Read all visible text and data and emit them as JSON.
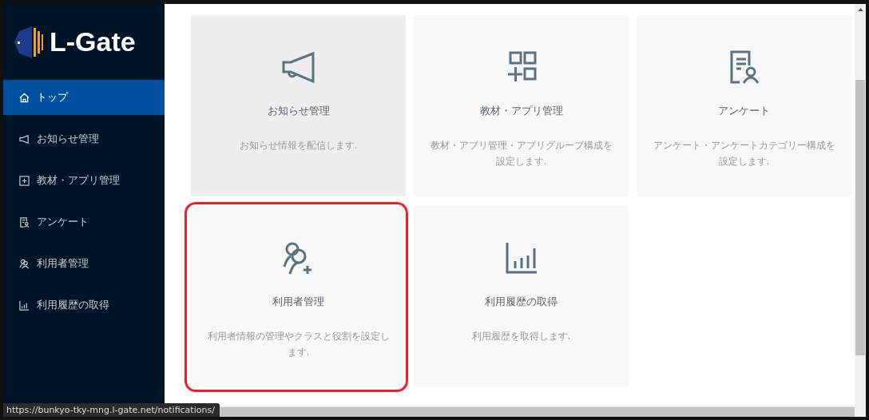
{
  "sidebar": {
    "logo": "L-Gate",
    "items": [
      {
        "label": "トップ",
        "selected": true
      },
      {
        "label": "お知らせ管理",
        "selected": false
      },
      {
        "label": "教材・アプリ管理",
        "selected": false
      },
      {
        "label": "アンケート",
        "selected": false
      },
      {
        "label": "利用者管理",
        "selected": false
      },
      {
        "label": "利用履歴の取得",
        "selected": false
      }
    ]
  },
  "cards": [
    {
      "title": "お知らせ管理",
      "description": "お知らせ情報を配信します.",
      "hovered": true,
      "highlighted": false
    },
    {
      "title": "教材・アプリ管理",
      "description": "教材・アプリ管理・アプリグループ構成を設定します.",
      "hovered": false,
      "highlighted": false
    },
    {
      "title": "アンケート",
      "description": "アンケート・アンケートカテゴリー構成を設定します.",
      "hovered": false,
      "highlighted": false
    },
    {
      "title": "利用者管理",
      "description": "利用者情報の管理やクラスと役割を設定します.",
      "hovered": false,
      "highlighted": true
    },
    {
      "title": "利用履歴の取得",
      "description": "利用履歴を取得します.",
      "hovered": false,
      "highlighted": false
    }
  ],
  "status_url": "https://bunkyo-tky-mng.l-gate.net/notifications/"
}
